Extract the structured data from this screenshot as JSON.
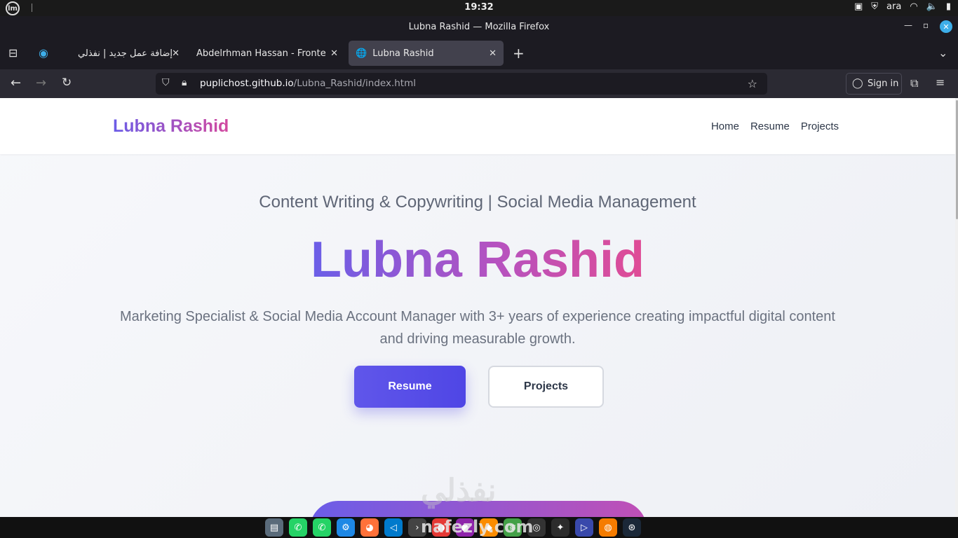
{
  "os": {
    "clock": "19:32",
    "keyboard_layout": "ara"
  },
  "window": {
    "title": "Lubna Rashid — Mozilla Firefox"
  },
  "tabs": [
    {
      "label": "إضافة عمل جديد | نفذلي"
    },
    {
      "label": "Abdelrhman Hassan - Frontend"
    },
    {
      "label": "Lubna Rashid"
    }
  ],
  "address_bar": {
    "host": "puplichost.github.io",
    "path": "/Lubna_Rashid/index.html"
  },
  "toolbar": {
    "sign_in_label": "Sign in"
  },
  "site": {
    "brand": "Lubna Rashid",
    "nav": [
      "Home",
      "Resume",
      "Projects"
    ],
    "subtitle": "Content Writing & Copywriting | Social Media Management",
    "hero_name": "Lubna Rashid",
    "description": "Marketing Specialist & Social Media Account Manager with 3+ years of experience creating impactful digital content and driving measurable growth.",
    "primary_button": "Resume",
    "secondary_button": "Projects"
  },
  "watermark": {
    "arabic": "نفذلي",
    "latin": "nafezly.com"
  },
  "colors": {
    "brand_gradient_start": "#6a5ee8",
    "brand_gradient_end": "#e04c95",
    "primary_button": "#4f46e5",
    "browser_chrome": "#1c1b22",
    "accent_blue": "#3daee9"
  }
}
